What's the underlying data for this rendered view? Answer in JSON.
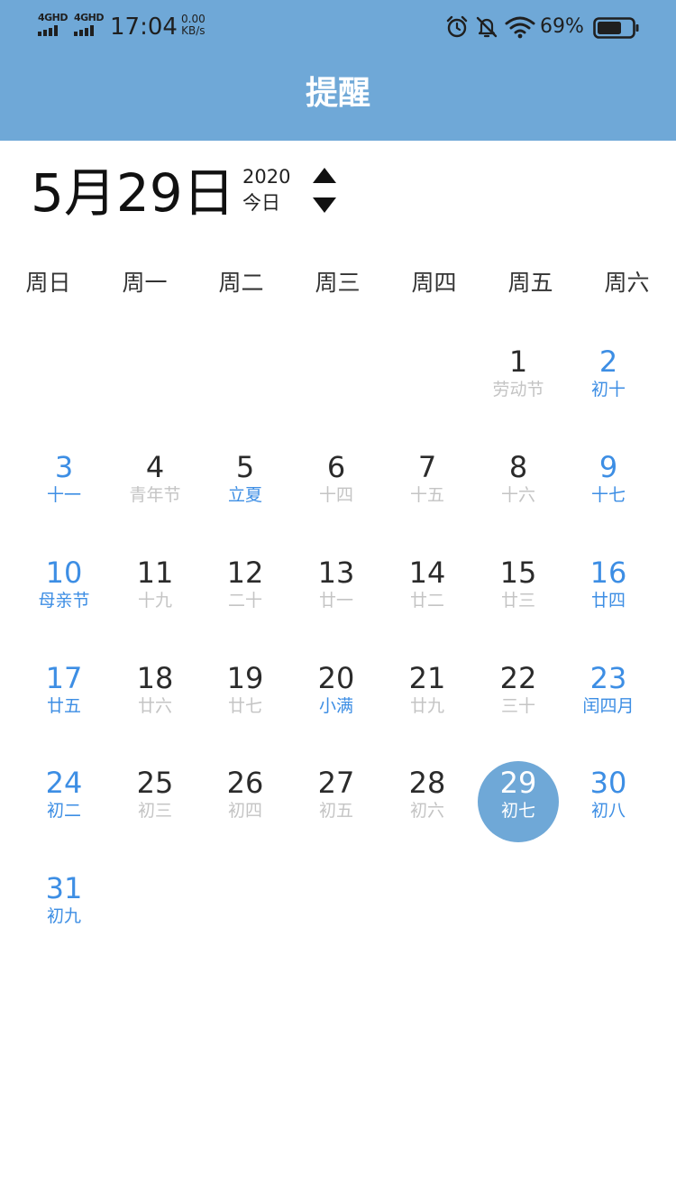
{
  "status_bar": {
    "network1": "4GHD",
    "network2": "4GHD",
    "time": "17:04",
    "speed_value": "0.00",
    "speed_unit": "KB/s",
    "battery_percent": "69%",
    "icons": [
      "alarm-icon",
      "mute-icon",
      "wifi-icon",
      "battery-icon"
    ],
    "battery_level": 0.69
  },
  "header": {
    "title": "提醒"
  },
  "date_header": {
    "big_date": "5月29日",
    "year": "2020",
    "today_label": "今日"
  },
  "weekdays": [
    "周日",
    "周一",
    "周二",
    "周三",
    "周四",
    "周五",
    "周六"
  ],
  "colors": {
    "primary": "#6fa8d7",
    "accent_text": "#3d8ee4",
    "muted_text": "#c4c4c4",
    "day_text": "#2b2b2b"
  },
  "calendar": {
    "days": [
      {
        "n": "1",
        "sub": "劳动节"
      },
      {
        "n": "2",
        "sub": "初十"
      },
      {
        "n": "3",
        "sub": "十一"
      },
      {
        "n": "4",
        "sub": "青年节"
      },
      {
        "n": "5",
        "sub": "立夏",
        "term": true
      },
      {
        "n": "6",
        "sub": "十四"
      },
      {
        "n": "7",
        "sub": "十五"
      },
      {
        "n": "8",
        "sub": "十六"
      },
      {
        "n": "9",
        "sub": "十七"
      },
      {
        "n": "10",
        "sub": "母亲节"
      },
      {
        "n": "11",
        "sub": "十九"
      },
      {
        "n": "12",
        "sub": "二十"
      },
      {
        "n": "13",
        "sub": "廿一"
      },
      {
        "n": "14",
        "sub": "廿二"
      },
      {
        "n": "15",
        "sub": "廿三"
      },
      {
        "n": "16",
        "sub": "廿四"
      },
      {
        "n": "17",
        "sub": "廿五"
      },
      {
        "n": "18",
        "sub": "廿六"
      },
      {
        "n": "19",
        "sub": "廿七"
      },
      {
        "n": "20",
        "sub": "小满",
        "term": true
      },
      {
        "n": "21",
        "sub": "廿九"
      },
      {
        "n": "22",
        "sub": "三十"
      },
      {
        "n": "23",
        "sub": "闰四月"
      },
      {
        "n": "24",
        "sub": "初二"
      },
      {
        "n": "25",
        "sub": "初三"
      },
      {
        "n": "26",
        "sub": "初四"
      },
      {
        "n": "27",
        "sub": "初五"
      },
      {
        "n": "28",
        "sub": "初六"
      },
      {
        "n": "29",
        "sub": "初七",
        "selected": true
      },
      {
        "n": "30",
        "sub": "初八"
      },
      {
        "n": "31",
        "sub": "初九"
      }
    ]
  }
}
